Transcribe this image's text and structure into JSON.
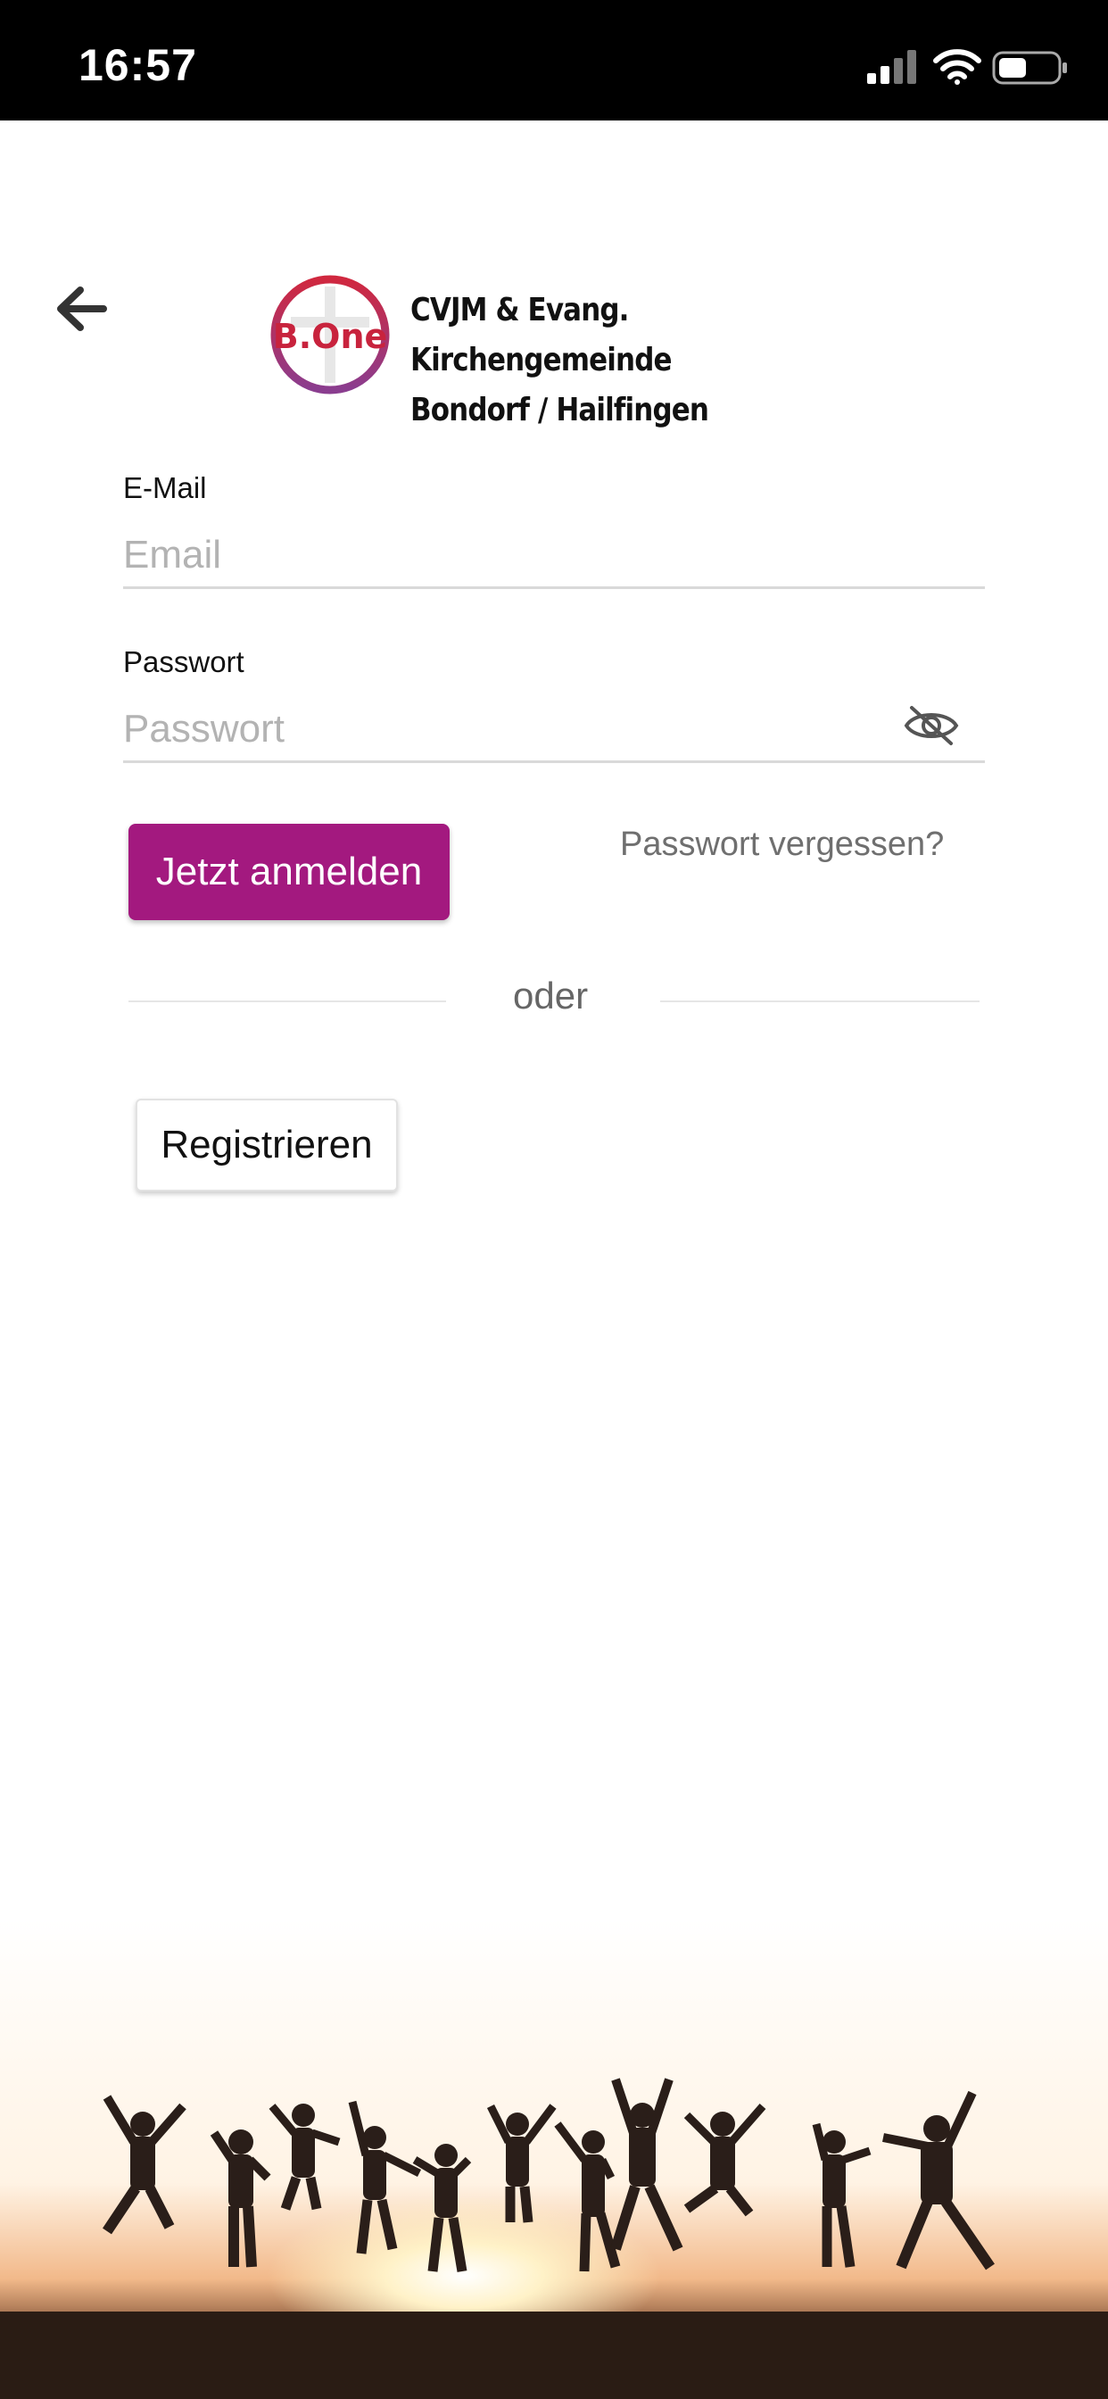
{
  "status_bar": {
    "time": "16:57",
    "icons": [
      "cellular-signal-icon",
      "wifi-icon",
      "battery-icon"
    ]
  },
  "header": {
    "back_icon": "arrow-left-icon",
    "logo_text": "B.One",
    "org_line1": "CVJM & Evang. Kirchengemeinde",
    "org_line2": "Bondorf / Hailfingen"
  },
  "form": {
    "email_label": "E-Mail",
    "email_placeholder": "Email",
    "email_value": "",
    "password_label": "Passwort",
    "password_placeholder": "Passwort",
    "password_value": "",
    "visibility_icon": "eye-off-icon",
    "login_button": "Jetzt anmelden",
    "forgot_link": "Passwort vergessen?",
    "divider_text": "oder",
    "register_button": "Registrieren"
  },
  "colors": {
    "primary": "#a3197f",
    "status_bar_bg": "#000000",
    "logo_red": "#d0283f",
    "logo_purple": "#8a3d8f"
  },
  "background_image": "people-jumping-on-beach-at-sunset-silhouette"
}
